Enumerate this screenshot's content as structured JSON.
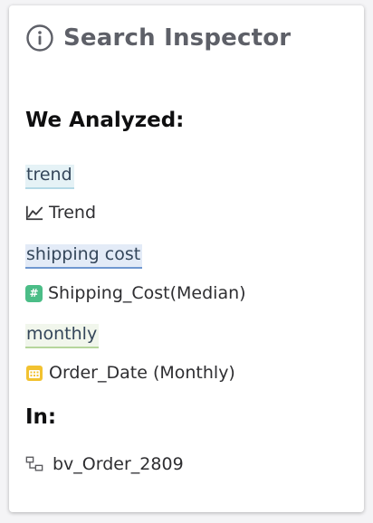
{
  "header": {
    "title": "Search Inspector",
    "icon": "info-icon"
  },
  "analyzed": {
    "title": "We Analyzed:",
    "items": [
      {
        "token": "trend",
        "mapping": "Trend",
        "icon": "line-chart-icon",
        "token_color": "#e5f2f6",
        "underline_color": "#b5d9e6"
      },
      {
        "token": "shipping cost",
        "mapping": "Shipping_Cost(Median)",
        "icon": "number-column-icon",
        "badge_text": "#",
        "token_color": "#e3ebf7",
        "underline_color": "#6f97d0",
        "icon_color": "#4bbd87"
      },
      {
        "token": "monthly",
        "mapping": "Order_Date (Monthly)",
        "icon": "calendar-icon",
        "token_color": "#f1f6ec",
        "underline_color": "#b6d69c",
        "icon_color": "#f2c230"
      }
    ]
  },
  "in": {
    "title": "In:",
    "source": "bv_Order_2809",
    "icon": "data-source-icon"
  }
}
